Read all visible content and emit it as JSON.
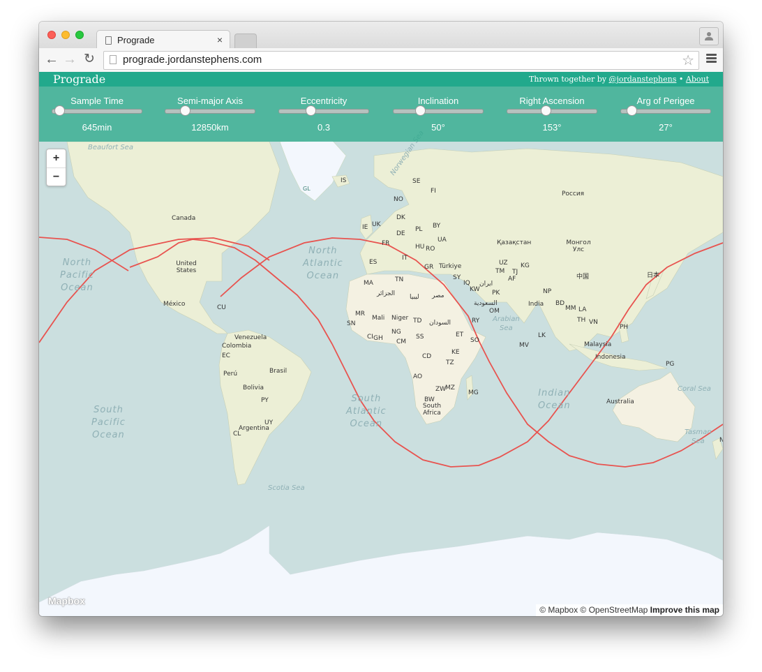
{
  "browser": {
    "tab_title": "Prograde",
    "tab_close": "×",
    "url": "prograde.jordanstephens.com",
    "back_icon": "←",
    "forward_icon": "→",
    "reload_icon": "↻",
    "star_icon": "☆"
  },
  "app": {
    "title": "Prograde",
    "credits_prefix": "Thrown together by ",
    "author_link": "@jordanstephens",
    "separator": " • ",
    "about_link": "About",
    "accent_color": "#22a98c"
  },
  "controls": [
    {
      "label": "Sample Time",
      "value": "645min",
      "position": 0.08
    },
    {
      "label": "Semi-major Axis",
      "value": "12850km",
      "position": 0.22
    },
    {
      "label": "Eccentricity",
      "value": "0.3",
      "position": 0.35
    },
    {
      "label": "Inclination",
      "value": "50°",
      "position": 0.3
    },
    {
      "label": "Right Ascension",
      "value": "153°",
      "position": 0.43
    },
    {
      "label": "Arg of Perigee",
      "value": "27°",
      "position": 0.12
    }
  ],
  "map": {
    "zoom_in": "+",
    "zoom_out": "−",
    "logo": "Mapbox",
    "attribution": "© Mapbox © OpenStreetMap ",
    "improve_link": "Improve this map",
    "orbit_color": "#e8534f",
    "oceans": [
      {
        "name": "North Pacific Ocean",
        "lines": [
          "North",
          "Pacific",
          "Ocean"
        ]
      },
      {
        "name": "North Atlantic Ocean",
        "lines": [
          "North",
          "Atlantic",
          "Ocean"
        ]
      },
      {
        "name": "South Pacific Ocean",
        "lines": [
          "South",
          "Pacific",
          "Ocean"
        ]
      },
      {
        "name": "South Atlantic Ocean",
        "lines": [
          "South",
          "Atlantic",
          "Ocean"
        ]
      },
      {
        "name": "Indian Ocean",
        "lines": [
          "Indian",
          "Ocean"
        ]
      }
    ],
    "seas": [
      "Arabian Sea",
      "Coral Sea",
      "Tasman Sea",
      "Scotia Sea",
      "Beaufort Sea",
      "Norwegian Sea"
    ],
    "labels": [
      "Canada",
      "United States",
      "México",
      "CU",
      "Venezuela",
      "Colombia",
      "EC",
      "Perú",
      "Bolivia",
      "Brasil",
      "PY",
      "UY",
      "Argentina",
      "CL",
      "IS",
      "NO",
      "SE",
      "FI",
      "DK",
      "UK",
      "IE",
      "PL",
      "BY",
      "DE",
      "FR",
      "HU",
      "RO",
      "UA",
      "IT",
      "ES",
      "GR",
      "Türkiye",
      "MA",
      "TN",
      "SY",
      "IQ",
      "KW",
      "ایران",
      "الجزائر",
      "ليبيا",
      "مصر",
      "السعودية",
      "MR",
      "Mali",
      "Niger",
      "TD",
      "السودان",
      "SN",
      "CI",
      "GH",
      "NG",
      "CM",
      "SS",
      "ET",
      "SO",
      "RY",
      "OM",
      "CD",
      "KE",
      "TZ",
      "AO",
      "ZW",
      "MZ",
      "MG",
      "BW",
      "South Africa",
      "Россия",
      "Қазақстан",
      "UZ",
      "KG",
      "TM",
      "TJ",
      "AF",
      "PK",
      "Монгол Улс",
      "中国",
      "日本",
      "NP",
      "India",
      "BD",
      "MM",
      "LA",
      "TH",
      "VN",
      "LK",
      "MV",
      "PH",
      "Malaysia",
      "Indonesia",
      "PG",
      "Australia",
      "GL",
      "N"
    ]
  }
}
